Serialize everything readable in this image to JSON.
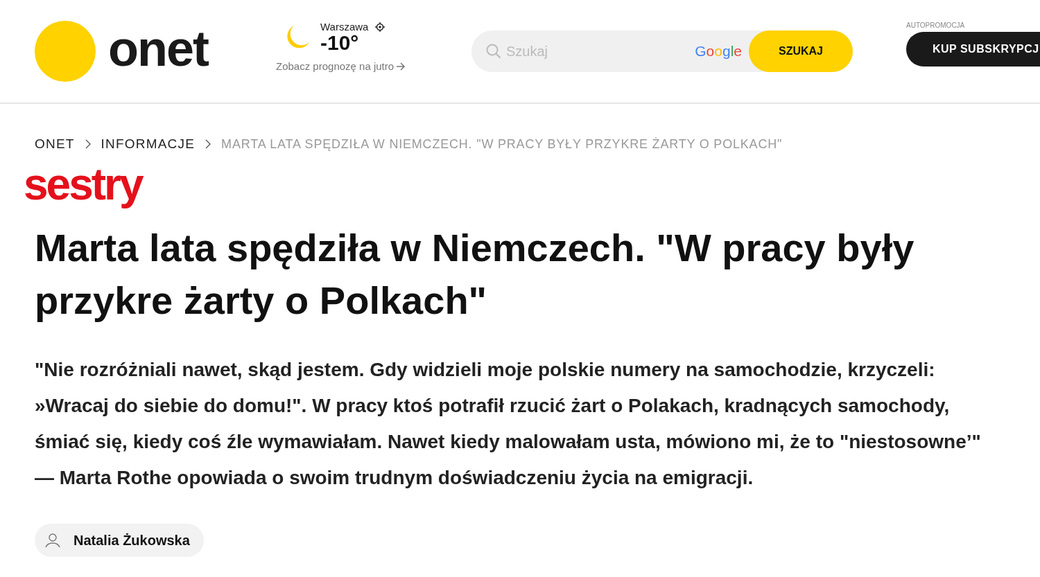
{
  "header": {
    "logo": "onet",
    "weather": {
      "city": "Warszawa",
      "temperature": "-10°",
      "forecast_link": "Zobacz prognozę na jutro"
    },
    "search": {
      "placeholder": "Szukaj",
      "provider": "Google",
      "button": "SZUKAJ"
    },
    "promo": {
      "label": "AUTOPROMOCJA",
      "button": "KUP SUBSKRYPCJ"
    }
  },
  "breadcrumbs": [
    {
      "label": "ONET",
      "current": false
    },
    {
      "label": "INFORMACJE",
      "current": false
    },
    {
      "label": "MARTA LATA SPĘDZIŁA W NIEMCZECH. \"W PRACY BYŁY PRZYKRE ŻARTY O POLKACH\"",
      "current": true
    }
  ],
  "section_logo": "sestry",
  "article": {
    "title": "Marta lata spędziła w Niemczech. \"W pracy były przykre żarty o Polkach\"",
    "lead": "\"Nie rozróżniali nawet, skąd jestem. Gdy widzieli moje polskie numery na samochodzie, krzyczeli: »Wracaj do siebie do domu!\". W pracy ktoś potrafił rzucić żart o Polakach, kradnących samochody, śmiać się, kiedy coś źle wymawiałam. Nawet kiedy malowałam usta, mówiono mi, że to \"niestosowne’\" — Marta Rothe opowiada o swoim trudnym doświadczeniu życia na emigracji.",
    "author": "Natalia Żukowska"
  }
}
